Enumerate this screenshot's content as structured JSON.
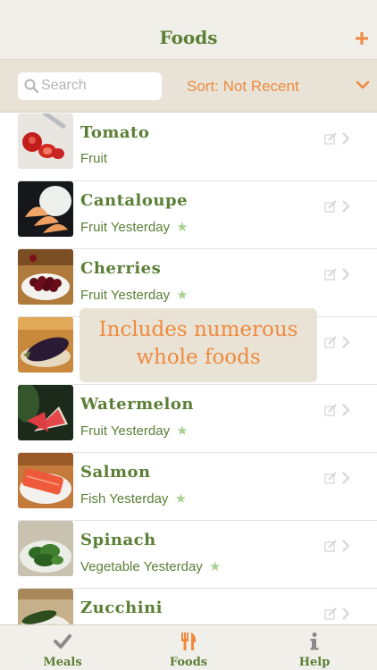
{
  "nav": {
    "title": "Foods",
    "add_icon": "plus-icon"
  },
  "filter": {
    "search_placeholder": "Search",
    "sort_label": "Sort: Not Recent"
  },
  "foods": [
    {
      "name": "Tomato",
      "category": "Fruit",
      "when": "",
      "starred": false,
      "thumb": "tomato-photo"
    },
    {
      "name": "Cantaloupe",
      "category": "Fruit",
      "when": "Yesterday",
      "starred": true,
      "thumb": "cantaloupe-photo"
    },
    {
      "name": "Cherries",
      "category": "Fruit",
      "when": "Yesterday",
      "starred": true,
      "thumb": "cherries-photo"
    },
    {
      "name": "",
      "category": "",
      "when": "",
      "starred": false,
      "thumb": "eggplant-photo"
    },
    {
      "name": "Watermelon",
      "category": "Fruit",
      "when": "Yesterday",
      "starred": true,
      "thumb": "watermelon-photo"
    },
    {
      "name": "Salmon",
      "category": "Fish",
      "when": "Yesterday",
      "starred": true,
      "thumb": "salmon-photo"
    },
    {
      "name": "Spinach",
      "category": "Vegetable",
      "when": "Yesterday",
      "starred": true,
      "thumb": "spinach-photo"
    },
    {
      "name": "Zucchini",
      "category": "",
      "when": "",
      "starred": false,
      "thumb": "zucchini-photo"
    }
  ],
  "overlay": {
    "line1": "Includes numerous",
    "line2": "whole foods"
  },
  "tabs": [
    {
      "label": "Meals",
      "icon": "checkmark-icon"
    },
    {
      "label": "Foods",
      "icon": "fork-knife-icon"
    },
    {
      "label": "Help",
      "icon": "info-icon"
    }
  ],
  "colors": {
    "accent_green": "#5a7f35",
    "accent_orange": "#ef8a3f",
    "star_green": "#a8d190",
    "header_bg": "#f1efe9",
    "filter_bg": "#e8e3d6"
  }
}
